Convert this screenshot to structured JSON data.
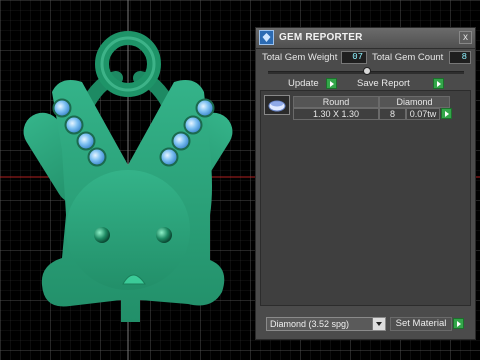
{
  "panel": {
    "title": "GEM REPORTER",
    "close_glyph": "x",
    "total_weight_label": "Total Gem Weight",
    "total_weight_value": "07",
    "total_count_label": "Total Gem Count",
    "total_count_value": "8",
    "update_label": "Update",
    "save_report_label": "Save Report",
    "table": {
      "headers": [
        "Round",
        "Diamond"
      ],
      "row": {
        "size": "1.30 X 1.30",
        "count": "8",
        "weight": "0.07tw"
      }
    },
    "material_select_value": "Diamond   (3.52 spg)",
    "set_material_label": "Set Material"
  },
  "colors": {
    "accent_green": "#33a64a",
    "model_green": "#2aa57c",
    "gem_blue": "#5fa8e6",
    "field_text": "#8ff2ff"
  },
  "icons": [
    "gem-reporter-app-icon",
    "close-icon",
    "update-go-icon",
    "save-report-go-icon",
    "round-gem-thumbnail",
    "dropdown-arrow-icon",
    "set-material-go-icon",
    "row-action-icon"
  ]
}
